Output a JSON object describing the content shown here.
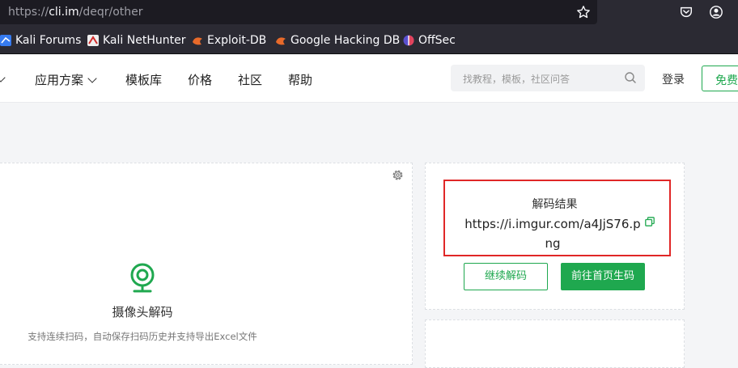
{
  "browser": {
    "url_scheme": "https://",
    "url_host": "cli.im",
    "url_path": "/deqr/other",
    "bookmarks": [
      {
        "label": "Kali Forums",
        "icon": "kali-dragon-icon"
      },
      {
        "label": "Kali NetHunter",
        "icon": "kali-nethunter-icon"
      },
      {
        "label": "Exploit-DB",
        "icon": "exploit-db-icon"
      },
      {
        "label": "Google Hacking DB",
        "icon": "google-hacking-db-icon"
      },
      {
        "label": "OffSec",
        "icon": "offsec-icon"
      }
    ]
  },
  "nav": {
    "solutions": "应用方案",
    "templates": "模板库",
    "pricing": "价格",
    "community": "社区",
    "help": "帮助",
    "search_placeholder": "找教程，模板，社区问答",
    "login": "登录",
    "free_signup": "免费"
  },
  "camera_panel": {
    "title": "摄像头解码",
    "description": "支持连续扫码，自动保存扫码历史并支持导出Excel文件"
  },
  "result_panel": {
    "title": "解码结果",
    "url": "https://i.imgur.com/a4JjS76.png",
    "continue_button": "继续解码",
    "goto_button": "前往首页生码"
  },
  "colors": {
    "brand_green": "#1fa84f",
    "highlight_red": "#e02727",
    "browser_dark": "#2b2a33"
  }
}
